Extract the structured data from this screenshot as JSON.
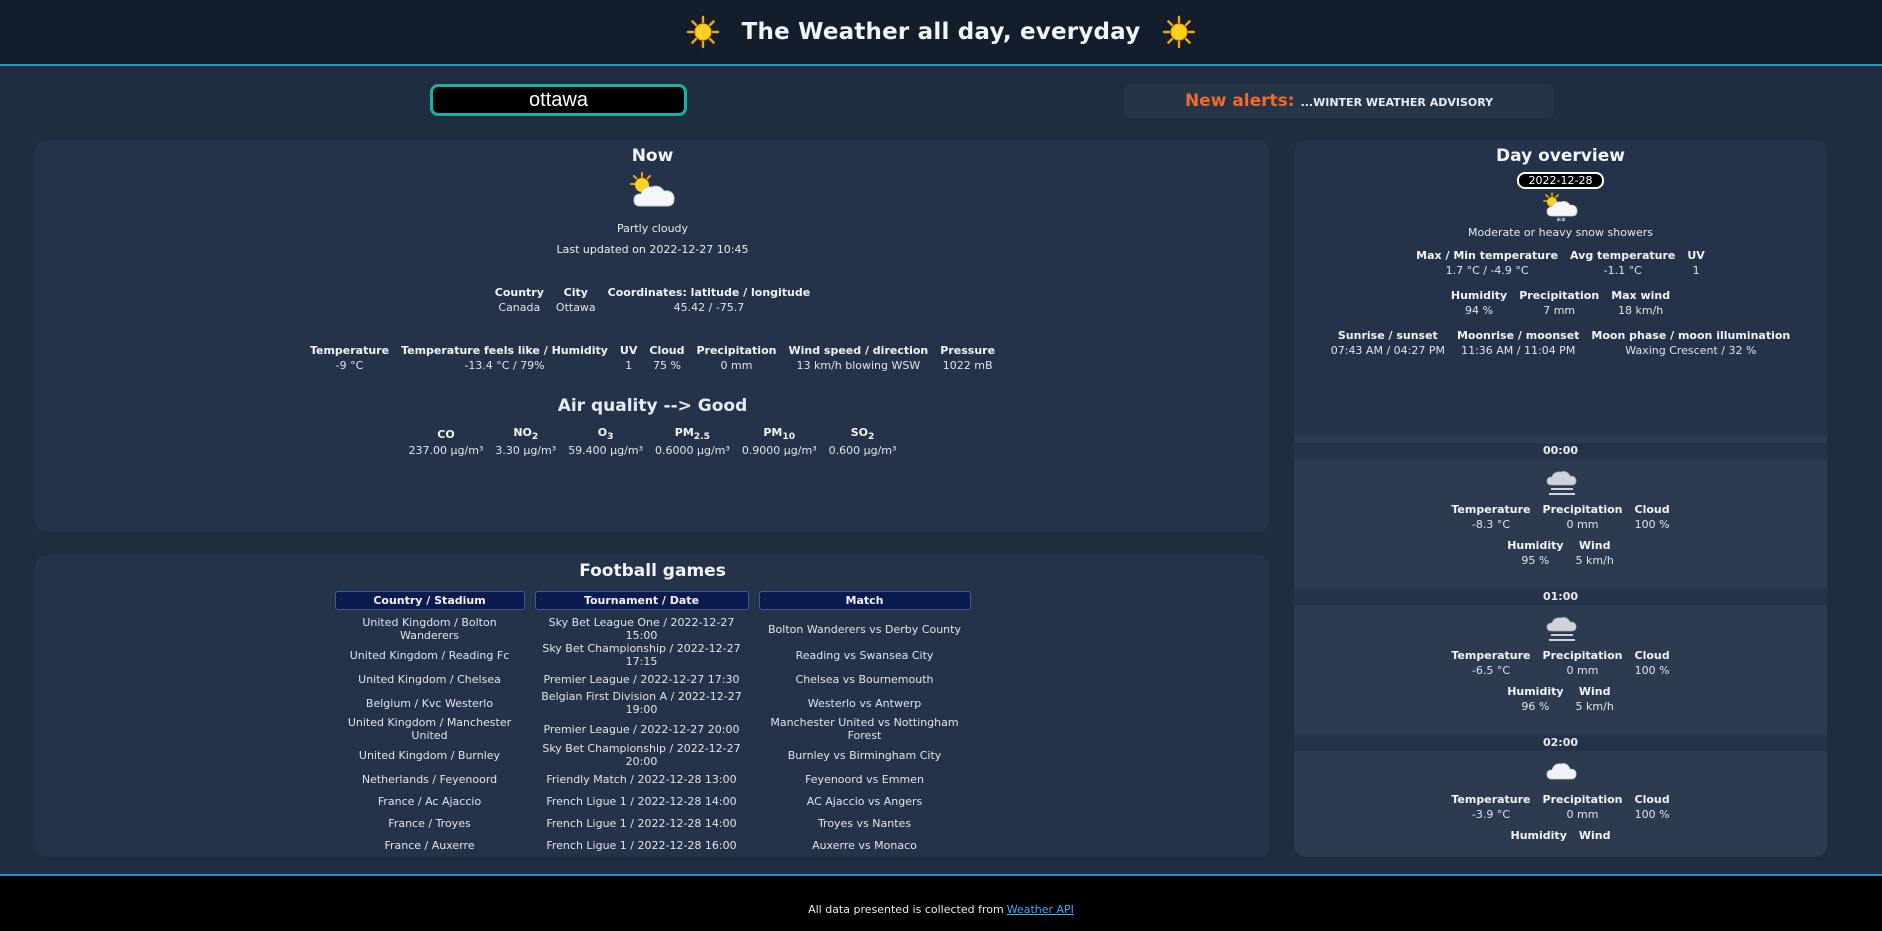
{
  "header": {
    "title": "The Weather all day, everyday",
    "left_icon": "sun-icon",
    "right_icon": "sun-icon"
  },
  "search": {
    "value": "ottawa",
    "placeholder": ""
  },
  "alerts": {
    "label": "New alerts:",
    "text": "...WINTER WEATHER ADVISORY"
  },
  "now": {
    "title": "Now",
    "icon": "partly-cloudy-icon",
    "condition": "Partly cloudy",
    "last_updated": "Last updated on 2022-12-27 10:45",
    "location": {
      "headers": [
        "Country",
        "City",
        "Coordinates: latitude / longitude"
      ],
      "values": [
        "Canada",
        "Ottawa",
        "45.42 / -75.7"
      ]
    },
    "details": {
      "headers": [
        "Temperature",
        "Temperature feels like / Humidity",
        "UV",
        "Cloud",
        "Precipitation",
        "Wind speed / direction",
        "Pressure"
      ],
      "values": [
        "-9 °C",
        "-13.4 °C / 79%",
        "1",
        "75 %",
        "0 mm",
        "13 km/h blowing WSW",
        "1022 mB"
      ]
    },
    "air_quality": {
      "title": "Air quality --> Good",
      "pollutants": [
        {
          "base": "CO",
          "sub": "",
          "value": "237.00 µg/m³"
        },
        {
          "base": "NO",
          "sub": "2",
          "value": "3.30 µg/m³"
        },
        {
          "base": "O",
          "sub": "3",
          "value": "59.400 µg/m³"
        },
        {
          "base": "PM",
          "sub": "2.5",
          "value": "0.6000 µg/m³"
        },
        {
          "base": "PM",
          "sub": "10",
          "value": "0.9000 µg/m³"
        },
        {
          "base": "SO",
          "sub": "2",
          "value": "0.600 µg/m³"
        }
      ]
    }
  },
  "football": {
    "title": "Football games",
    "headers": [
      "Country / Stadium",
      "Tournament / Date",
      "Match"
    ],
    "rows": [
      [
        "United Kingdom / Bolton Wanderers",
        "Sky Bet League One / 2022-12-27 15:00",
        "Bolton Wanderers vs Derby County"
      ],
      [
        "United Kingdom / Reading Fc",
        "Sky Bet Championship / 2022-12-27 17:15",
        "Reading vs Swansea City"
      ],
      [
        "United Kingdom / Chelsea",
        "Premier League / 2022-12-27 17:30",
        "Chelsea vs Bournemouth"
      ],
      [
        "Belgium / Kvc Westerlo",
        "Belgian First Division A / 2022-12-27 19:00",
        "Westerlo vs Antwerp"
      ],
      [
        "United Kingdom / Manchester United",
        "Premier League / 2022-12-27 20:00",
        "Manchester United vs Nottingham Forest"
      ],
      [
        "United Kingdom / Burnley",
        "Sky Bet Championship / 2022-12-27 20:00",
        "Burnley vs Birmingham City"
      ],
      [
        "Netherlands / Feyenoord",
        "Friendly Match / 2022-12-28 13:00",
        "Feyenoord vs Emmen"
      ],
      [
        "France / Ac Ajaccio",
        "French Ligue 1 / 2022-12-28 14:00",
        "AC Ajaccio vs Angers"
      ],
      [
        "France / Troyes",
        "French Ligue 1 / 2022-12-28 14:00",
        "Troyes vs Nantes"
      ],
      [
        "France / Auxerre",
        "French Ligue 1 / 2022-12-28 16:00",
        "Auxerre vs Monaco"
      ]
    ]
  },
  "day": {
    "title": "Day overview",
    "date": "2022-12-28",
    "icon": "snow-showers-icon",
    "condition": "Moderate or heavy snow showers",
    "row1": {
      "headers": [
        "Max / Min temperature",
        "Avg temperature",
        "UV"
      ],
      "values": [
        "1.7 °C / -4.9 °C",
        "-1.1 °C",
        "1"
      ]
    },
    "row2": {
      "headers": [
        "Humidity",
        "Precipitation",
        "Max wind"
      ],
      "values": [
        "94 %",
        "7 mm",
        "18 km/h"
      ]
    },
    "row3": {
      "headers": [
        "Sunrise / sunset",
        "Moonrise / moonset",
        "Moon phase / moon illumination"
      ],
      "values": [
        "07:43 AM / 04:27 PM",
        "11:36 AM / 11:04 PM",
        "Waxing Crescent / 32 %"
      ]
    },
    "hours": [
      {
        "time": "00:00",
        "icon": "fog-cloud-icon",
        "labels": [
          "Temperature",
          "Precipitation",
          "Cloud"
        ],
        "values": [
          "-8.3 °C",
          "0 mm",
          "100 %"
        ],
        "labels2": [
          "Humidity",
          "Wind"
        ],
        "values2": [
          "95 %",
          "5 km/h"
        ]
      },
      {
        "time": "01:00",
        "icon": "fog-cloud-icon",
        "labels": [
          "Temperature",
          "Precipitation",
          "Cloud"
        ],
        "values": [
          "-6.5 °C",
          "0 mm",
          "100 %"
        ],
        "labels2": [
          "Humidity",
          "Wind"
        ],
        "values2": [
          "96 %",
          "5 km/h"
        ]
      },
      {
        "time": "02:00",
        "icon": "cloud-icon",
        "labels": [
          "Temperature",
          "Precipitation",
          "Cloud"
        ],
        "values": [
          "-3.9 °C",
          "0 mm",
          "100 %"
        ],
        "labels2": [
          "Humidity",
          "Wind"
        ],
        "values2": [
          "",
          ""
        ]
      }
    ]
  },
  "footer": {
    "text": "All data presented is collected from",
    "link": "Weather API"
  },
  "colors": {
    "accent": "#1f9bbd",
    "alert": "#f06a2b",
    "search_border": "#18b1a6",
    "panel": "#25334a"
  }
}
